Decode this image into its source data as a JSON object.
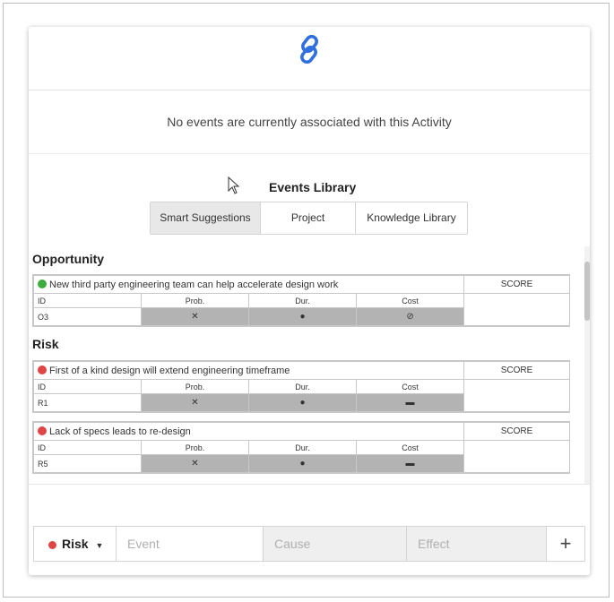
{
  "header": {
    "link_icon": "link-icon",
    "accent_color": "#2f6fe0"
  },
  "empty_message": "No events are currently associated with this Activity",
  "library": {
    "title": "Events Library",
    "tabs": [
      "Smart Suggestions",
      "Project",
      "Knowledge Library"
    ],
    "active_tab": "Smart Suggestions"
  },
  "sections": {
    "opportunity": {
      "title": "Opportunity",
      "events": [
        {
          "status_color": "#3dac3d",
          "text": "New third party engineering team can help accelerate design work",
          "score_label": "SCORE",
          "columns": [
            "ID",
            "Prob.",
            "Dur.",
            "Cost"
          ],
          "id": "O3",
          "icons": [
            "✕",
            "●",
            "⊘"
          ]
        }
      ]
    },
    "risk": {
      "title": "Risk",
      "events": [
        {
          "status_color": "#e04545",
          "text": "First of a kind design will extend engineering timeframe",
          "score_label": "SCORE",
          "columns": [
            "ID",
            "Prob.",
            "Dur.",
            "Cost"
          ],
          "id": "R1",
          "icons": [
            "✕",
            "●",
            "▬"
          ]
        },
        {
          "status_color": "#e04545",
          "text": "Lack of specs leads to re-design",
          "score_label": "SCORE",
          "columns": [
            "ID",
            "Prob.",
            "Dur.",
            "Cost"
          ],
          "id": "R5",
          "icons": [
            "✕",
            "●",
            "▬"
          ]
        }
      ]
    }
  },
  "input_bar": {
    "type_label": "Risk",
    "type_color": "#e04545",
    "event_placeholder": "Event",
    "cause_placeholder": "Cause",
    "effect_placeholder": "Effect",
    "add_symbol": "+"
  }
}
